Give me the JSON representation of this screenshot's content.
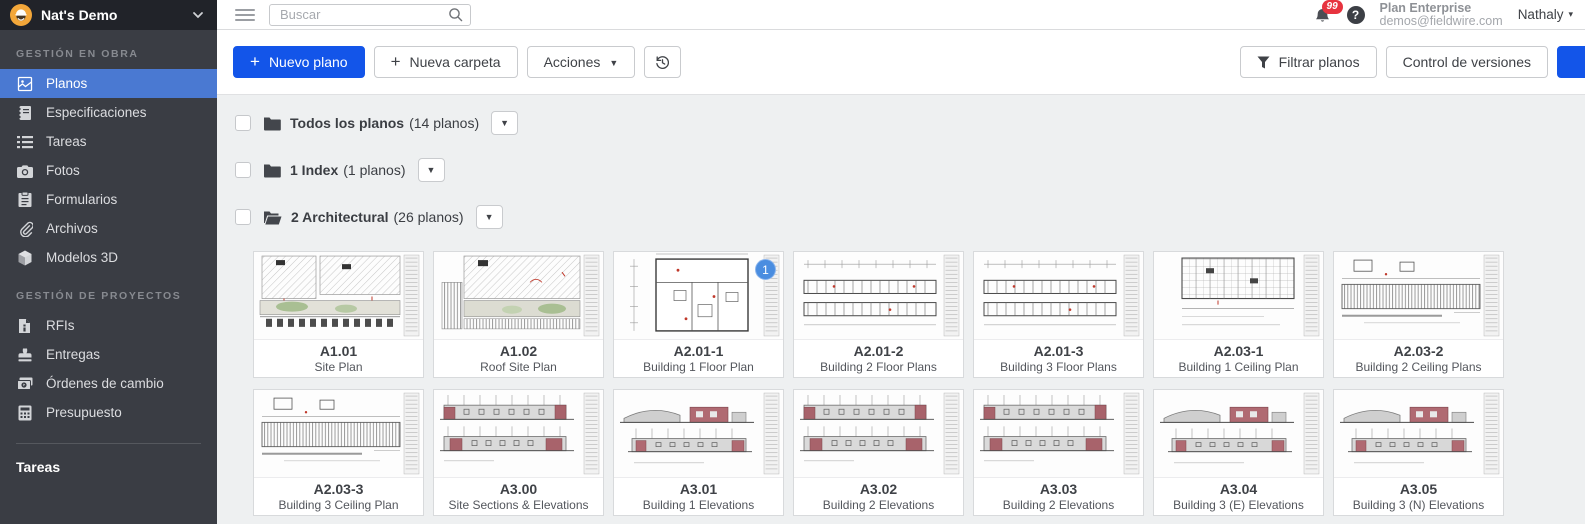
{
  "app": {
    "project_name": "Nat's Demo",
    "accent_blue": "#1355e9",
    "brand_orange": "#f3a73a",
    "active_item_blue": "#4a79d2",
    "badge_red": "#e7333f"
  },
  "topbar": {
    "search_placeholder": "Buscar",
    "notification_count": "99",
    "help_label": "?",
    "plan_name": "Plan Enterprise",
    "plan_email": "demos@fieldwire.com",
    "user_name": "Nathaly"
  },
  "sidebar": {
    "sections": [
      {
        "title": "GESTIÓN EN OBRA",
        "items": [
          {
            "label": "Planos",
            "icon": "plans-icon",
            "active": true
          },
          {
            "label": "Especificaciones",
            "icon": "specs-icon"
          },
          {
            "label": "Tareas",
            "icon": "tasks-icon"
          },
          {
            "label": "Fotos",
            "icon": "photos-icon"
          },
          {
            "label": "Formularios",
            "icon": "forms-icon"
          },
          {
            "label": "Archivos",
            "icon": "files-icon"
          },
          {
            "label": "Modelos 3D",
            "icon": "models-3d-icon"
          }
        ]
      },
      {
        "title": "GESTIÓN DE PROYECTOS",
        "items": [
          {
            "label": "RFIs",
            "icon": "rfi-icon"
          },
          {
            "label": "Entregas",
            "icon": "submittals-icon"
          },
          {
            "label": "Órdenes de cambio",
            "icon": "change-orders-icon"
          },
          {
            "label": "Presupuesto",
            "icon": "budget-icon"
          }
        ]
      }
    ],
    "footer_label": "Tareas"
  },
  "toolbar": {
    "new_plan_label": "Nuevo plano",
    "new_folder_label": "Nueva carpeta",
    "actions_label": "Acciones",
    "filter_plans_label": "Filtrar planos",
    "version_control_label": "Control de versiones"
  },
  "folders": [
    {
      "name": "Todos los planos",
      "count": "(14 planos)",
      "state": "closed"
    },
    {
      "name": "1 Index",
      "count": "(1 planos)",
      "state": "closed"
    },
    {
      "name": "2 Architectural",
      "count": "(26 planos)",
      "state": "open",
      "rows": [
        [
          {
            "code": "A1.01",
            "name": "Site Plan",
            "variant": "site"
          },
          {
            "code": "A1.02",
            "name": "Roof Site Plan",
            "variant": "site2"
          },
          {
            "code": "A2.01-1",
            "name": "Building 1 Floor Plan",
            "variant": "floor",
            "badge": "1"
          },
          {
            "code": "A2.01-2",
            "name": "Building 2 Floor Plans",
            "variant": "floor2"
          },
          {
            "code": "A2.01-3",
            "name": "Building 3 Floor Plans",
            "variant": "floor2"
          },
          {
            "code": "A2.03-1",
            "name": "Building 1 Ceiling Plan",
            "variant": "ceiling"
          },
          {
            "code": "A2.03-2",
            "name": "Building 2 Ceiling Plans",
            "variant": "ceiling2"
          }
        ],
        [
          {
            "code": "A2.03-3",
            "name": "Building 3 Ceiling Plan",
            "variant": "ceiling2"
          },
          {
            "code": "A3.00",
            "name": "Site Sections & Elevations",
            "variant": "elevation"
          },
          {
            "code": "A3.01",
            "name": "Building 1 Elevations",
            "variant": "elevation2"
          },
          {
            "code": "A3.02",
            "name": "Building 2 Elevations",
            "variant": "elevation"
          },
          {
            "code": "A3.03",
            "name": "Building 2 Elevations",
            "variant": "elevation"
          },
          {
            "code": "A3.04",
            "name": "Building 3 (E) Elevations",
            "variant": "elevation2"
          },
          {
            "code": "A3.05",
            "name": "Building 3 (N) Elevations",
            "variant": "elevation2"
          }
        ]
      ]
    }
  ]
}
